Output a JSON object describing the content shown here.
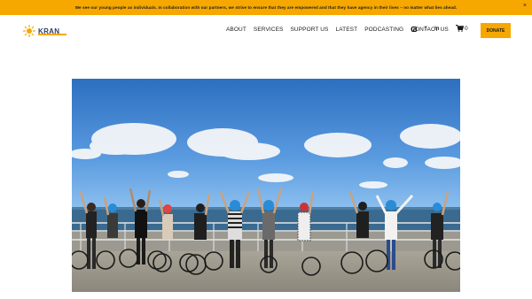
{
  "announcement": {
    "text": "We see our young people as individuals. In collaboration with our partners, we strive to ensure that they are empowered and that they have agency in their lives – no matter what lies ahead.",
    "close_symbol": "×"
  },
  "header": {
    "logo_text": "KRAN",
    "nav": [
      "ABOUT",
      "SERVICES",
      "SUPPORT US",
      "LATEST",
      "PODCASTING",
      "CONTACT US"
    ],
    "social": [
      {
        "name": "instagram-icon"
      },
      {
        "name": "facebook-icon",
        "glyph": "f"
      },
      {
        "name": "linkedin-icon",
        "glyph": "in"
      }
    ],
    "cart_count": "0",
    "donate_label": "DONATE"
  },
  "colors": {
    "accent": "#f6a800",
    "text": "#1a1a1a",
    "logo_blue": "#2c3e66"
  }
}
